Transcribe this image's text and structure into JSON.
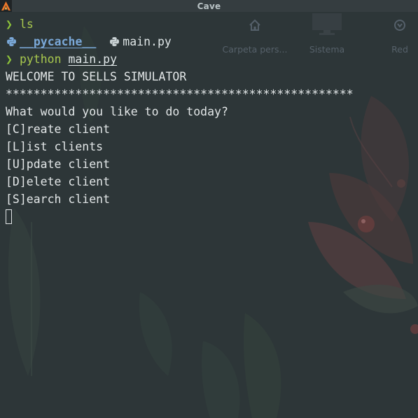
{
  "window": {
    "title": "Cave",
    "app_icon": "alacritty-icon"
  },
  "desktop_icons": [
    {
      "label": "Carpeta pers...",
      "icon": "home-icon"
    },
    {
      "label": "Sistema",
      "icon": "monitor-icon"
    },
    {
      "label": "Red",
      "icon": "network-icon"
    }
  ],
  "terminal": {
    "prompt_symbol": "❯",
    "lines": [
      {
        "command": "ls",
        "args": ""
      },
      {
        "listing": [
          {
            "name": "__pycache__",
            "type": "directory",
            "icon": "python-icon"
          },
          {
            "name": "main.py",
            "type": "file",
            "icon": "python-icon"
          }
        ]
      },
      {
        "command": "python",
        "args": "main.py"
      }
    ],
    "output": [
      "WELCOME TO SELLS SIMULATOR",
      "**************************************************",
      "What would you like to do today?",
      "[C]reate client",
      "[L]ist clients",
      "[U]pdate client",
      "[D]elete client",
      "[S]earch client"
    ]
  },
  "colors": {
    "background": "#2d3638",
    "prompt": "#8ec53a",
    "command": "#a8c84e",
    "directory": "#7aa8d8",
    "text": "#e3e7e8"
  }
}
